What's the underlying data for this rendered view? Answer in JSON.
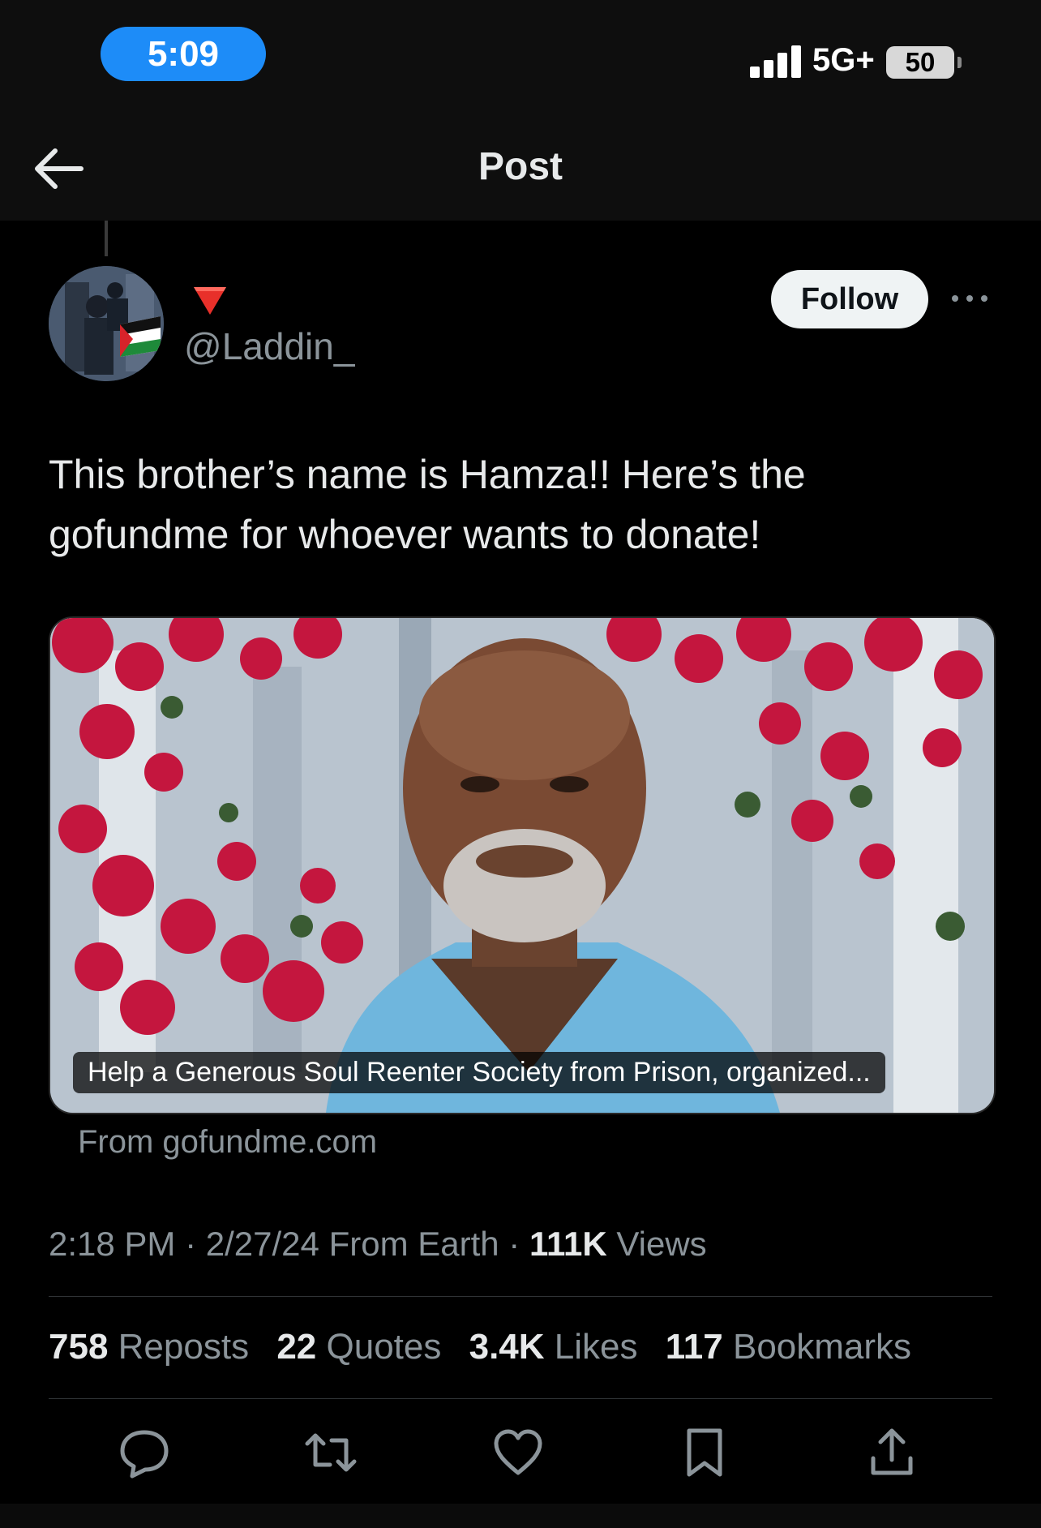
{
  "status_bar": {
    "time": "5:09",
    "network": "5G+",
    "battery": "50",
    "icons": [
      "signal-icon",
      "battery-icon"
    ]
  },
  "nav": {
    "title": "Post",
    "back_icon": "arrow-left-icon"
  },
  "author": {
    "name_emoji": "🔻",
    "handle": "@Laddin_",
    "follow_label": "Follow",
    "more_icon": "ellipsis-icon"
  },
  "tweet": {
    "text": "This brother’s name is Hamza!! Here’s the gofundme for whoever wants to donate!"
  },
  "link_card": {
    "title": "Help a Generous Soul Reenter Society from Prison, organized...",
    "source": "From gofundme.com"
  },
  "meta": {
    "time": "2:18 PM",
    "date": "2/27/24",
    "from": "From Earth",
    "views_count": "111K",
    "views_label": "Views"
  },
  "stats": {
    "reposts_count": "758",
    "reposts_label": "Reposts",
    "quotes_count": "22",
    "quotes_label": "Quotes",
    "likes_count": "3.4K",
    "likes_label": "Likes",
    "bookmarks_count": "117",
    "bookmarks_label": "Bookmarks"
  },
  "actions": [
    "reply-icon",
    "repost-icon",
    "like-icon",
    "bookmark-icon",
    "share-icon"
  ],
  "colors": {
    "background": "#000000",
    "text": "#e7e9ea",
    "secondary_text": "#8b949a",
    "time_pill": "#1d8cf8",
    "follow_bg": "#eff3f4"
  }
}
